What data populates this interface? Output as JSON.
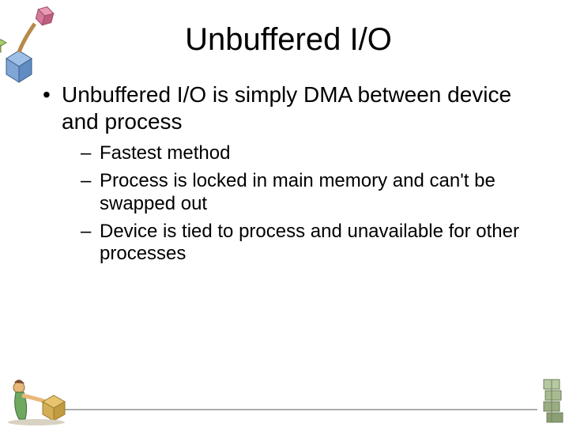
{
  "slide": {
    "title": "Unbuffered I/O",
    "bullets": [
      {
        "text": "Unbuffered I/O is simply DMA between device and process",
        "sub": [
          "Fastest method",
          "Process is locked in main memory and can't be swapped out",
          "Device is tied to process and unavailable for other processes"
        ]
      }
    ]
  }
}
